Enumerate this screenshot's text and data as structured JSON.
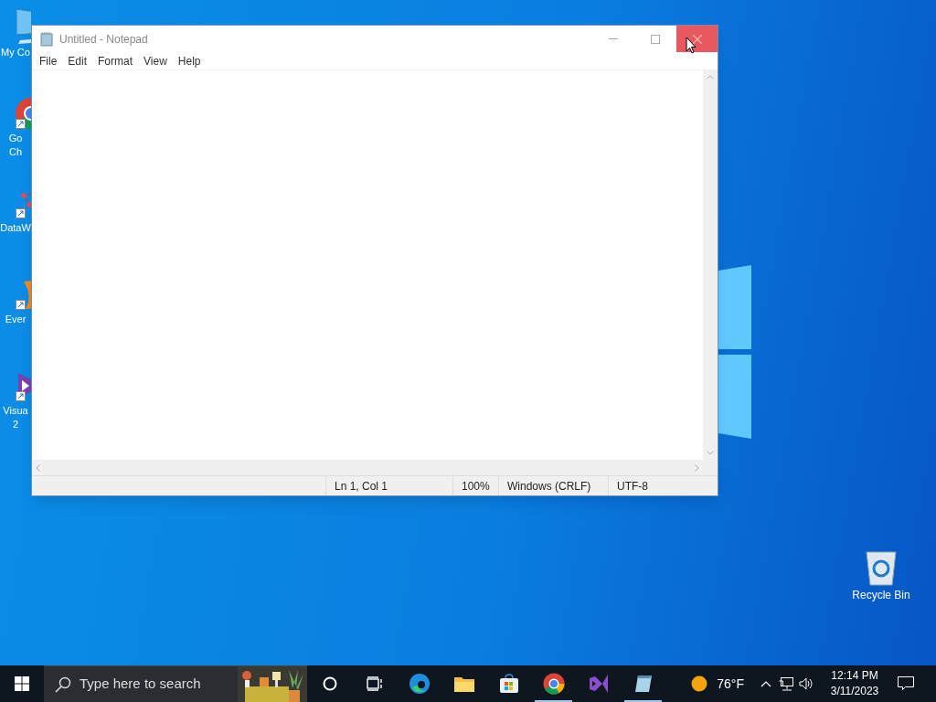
{
  "desktop_icons": [
    {
      "label": "My Co",
      "kind": "computer"
    },
    {
      "label": "Go\nCh",
      "kind": "chrome"
    },
    {
      "label": "DataW",
      "kind": "dataw"
    },
    {
      "label": "Ever",
      "kind": "ever"
    },
    {
      "label": "Visua\n2",
      "kind": "vs"
    },
    {
      "label": "Recycle Bin",
      "kind": "bin"
    }
  ],
  "window": {
    "title": "Untitled - Notepad",
    "menu": [
      "File",
      "Edit",
      "Format",
      "View",
      "Help"
    ],
    "status_bar": [
      "Ln 1, Col 1",
      "100%",
      "Windows (CRLF)",
      "UTF-8"
    ]
  },
  "taskbar": {
    "search": {
      "placeholder": "Type here to search"
    },
    "apps": [
      {
        "kind": "cortana",
        "running": false
      },
      {
        "kind": "taskview",
        "running": false
      },
      {
        "kind": "edge",
        "running": false
      },
      {
        "kind": "explorer",
        "running": false
      },
      {
        "kind": "store",
        "running": false
      },
      {
        "kind": "chrome",
        "running": true
      },
      {
        "kind": "vs",
        "running": false
      },
      {
        "kind": "notepad",
        "running": true
      }
    ],
    "weather": "76°F",
    "time": "12:14 PM",
    "date": "3/11/2023"
  }
}
